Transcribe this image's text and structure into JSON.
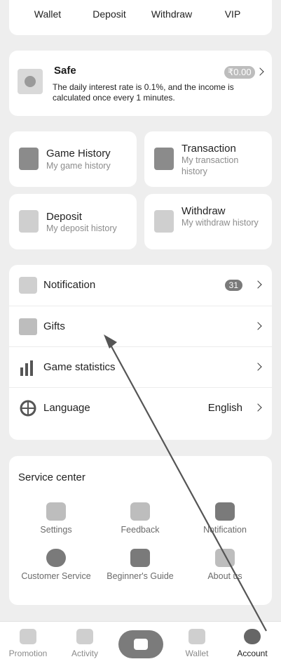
{
  "quick_actions": [
    {
      "label": "Wallet"
    },
    {
      "label": "Deposit"
    },
    {
      "label": "Withdraw"
    },
    {
      "label": "VIP"
    }
  ],
  "safe": {
    "title": "Safe",
    "amount": "₹0.00",
    "description": "The daily interest rate is 0.1%, and the income is calculated once every 1 minutes."
  },
  "history_cards": [
    {
      "title": "Game History",
      "subtitle": "My game history",
      "icon": "game-history-icon"
    },
    {
      "title": "Transaction",
      "subtitle": "My transaction history",
      "icon": "transaction-icon"
    },
    {
      "title": "Deposit",
      "subtitle": "My deposit history",
      "icon": "deposit-icon"
    },
    {
      "title": "Withdraw",
      "subtitle": "My withdraw history",
      "icon": "withdraw-icon"
    }
  ],
  "list_items": [
    {
      "label": "Notification",
      "badge": "31",
      "icon": "mail-icon"
    },
    {
      "label": "Gifts",
      "icon": "gift-icon"
    },
    {
      "label": "Game statistics",
      "icon": "bar-chart-icon"
    },
    {
      "label": "Language",
      "value": "English",
      "icon": "globe-icon"
    }
  ],
  "service_center": {
    "title": "Service center",
    "items": [
      {
        "label": "Settings",
        "icon": "gear-icon"
      },
      {
        "label": "Feedback",
        "icon": "feedback-icon"
      },
      {
        "label": "Notification",
        "icon": "megaphone-icon"
      },
      {
        "label": "Customer Service",
        "icon": "chat-icon"
      },
      {
        "label": "Beginner's Guide",
        "icon": "book-icon"
      },
      {
        "label": "About us",
        "icon": "cube-icon"
      }
    ]
  },
  "bottom_nav": {
    "items": [
      {
        "label": "Promotion",
        "icon": "heart-icon"
      },
      {
        "label": "Activity",
        "icon": "gift-icon"
      },
      {
        "label": "Wallet",
        "icon": "wallet-icon"
      },
      {
        "label": "Account",
        "icon": "user-icon"
      }
    ],
    "active": "Account"
  },
  "colors": {
    "background": "#eeeeee",
    "card": "#ffffff",
    "accent": "#7b7b7b"
  }
}
